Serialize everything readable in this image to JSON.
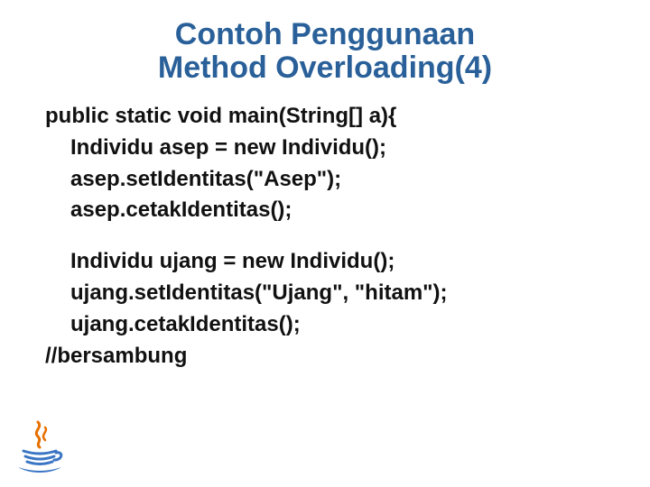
{
  "title": {
    "line1": "Contoh Penggunaan",
    "line2": "Method Overloading(4)"
  },
  "code": {
    "l1": "public static void main(String[] a){",
    "l2": "Individu asep = new Individu();",
    "l3": "asep.setIdentitas(\"Asep\");",
    "l4": "asep.cetakIdentitas();",
    "l5": "Individu ujang = new Individu();",
    "l6": "ujang.setIdentitas(\"Ujang\", \"hitam\");",
    "l7": "ujang.cetakIdentitas();",
    "l8": "//bersambung"
  }
}
